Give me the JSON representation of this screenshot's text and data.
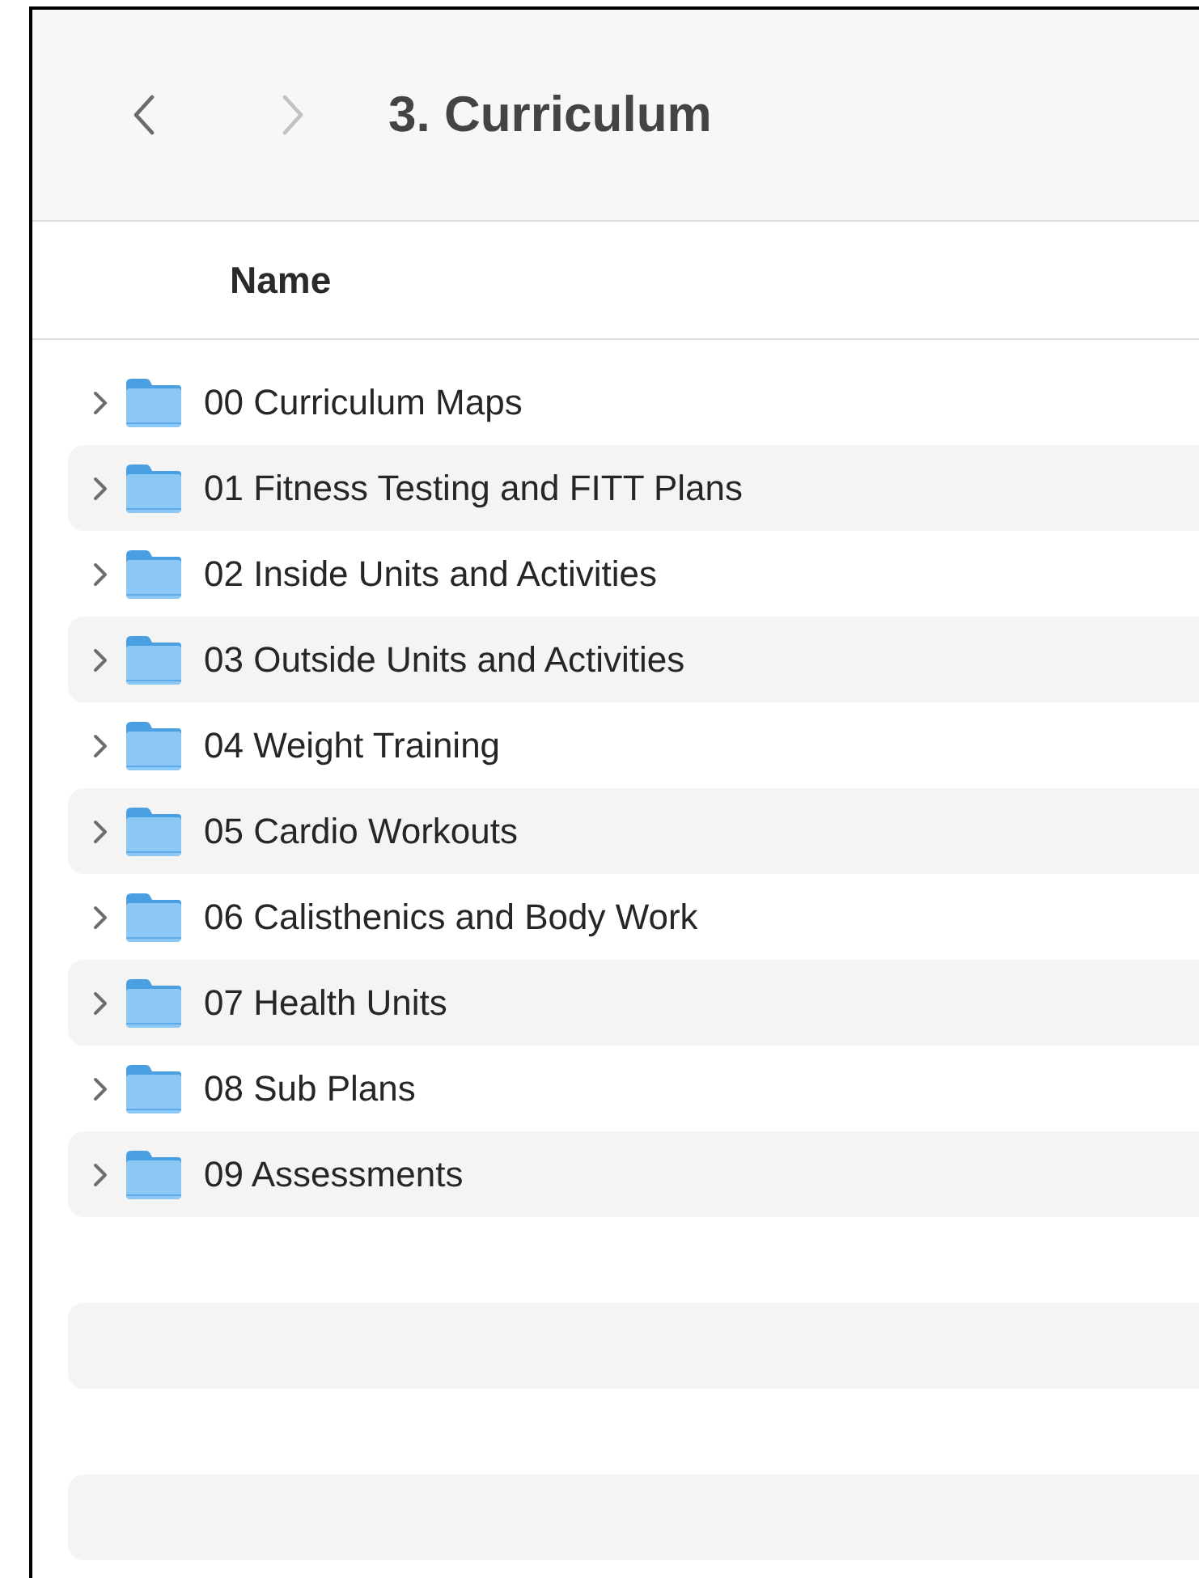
{
  "toolbar": {
    "back": {
      "disabled": false
    },
    "forward": {
      "disabled": true
    },
    "title": "3. Curriculum"
  },
  "table": {
    "columns": [
      "Name"
    ],
    "rows": [
      {
        "name": "00 Curriculum Maps",
        "expanded": false
      },
      {
        "name": "01 Fitness Testing and FITT Plans",
        "expanded": false
      },
      {
        "name": "02 Inside Units and Activities",
        "expanded": false
      },
      {
        "name": "03 Outside Units and Activities",
        "expanded": false
      },
      {
        "name": "04 Weight Training",
        "expanded": false
      },
      {
        "name": "05 Cardio Workouts",
        "expanded": false
      },
      {
        "name": "06 Calisthenics and Body Work",
        "expanded": false
      },
      {
        "name": "07 Health Units",
        "expanded": false
      },
      {
        "name": "08 Sub Plans",
        "expanded": false
      },
      {
        "name": "09 Assessments",
        "expanded": false
      }
    ]
  }
}
